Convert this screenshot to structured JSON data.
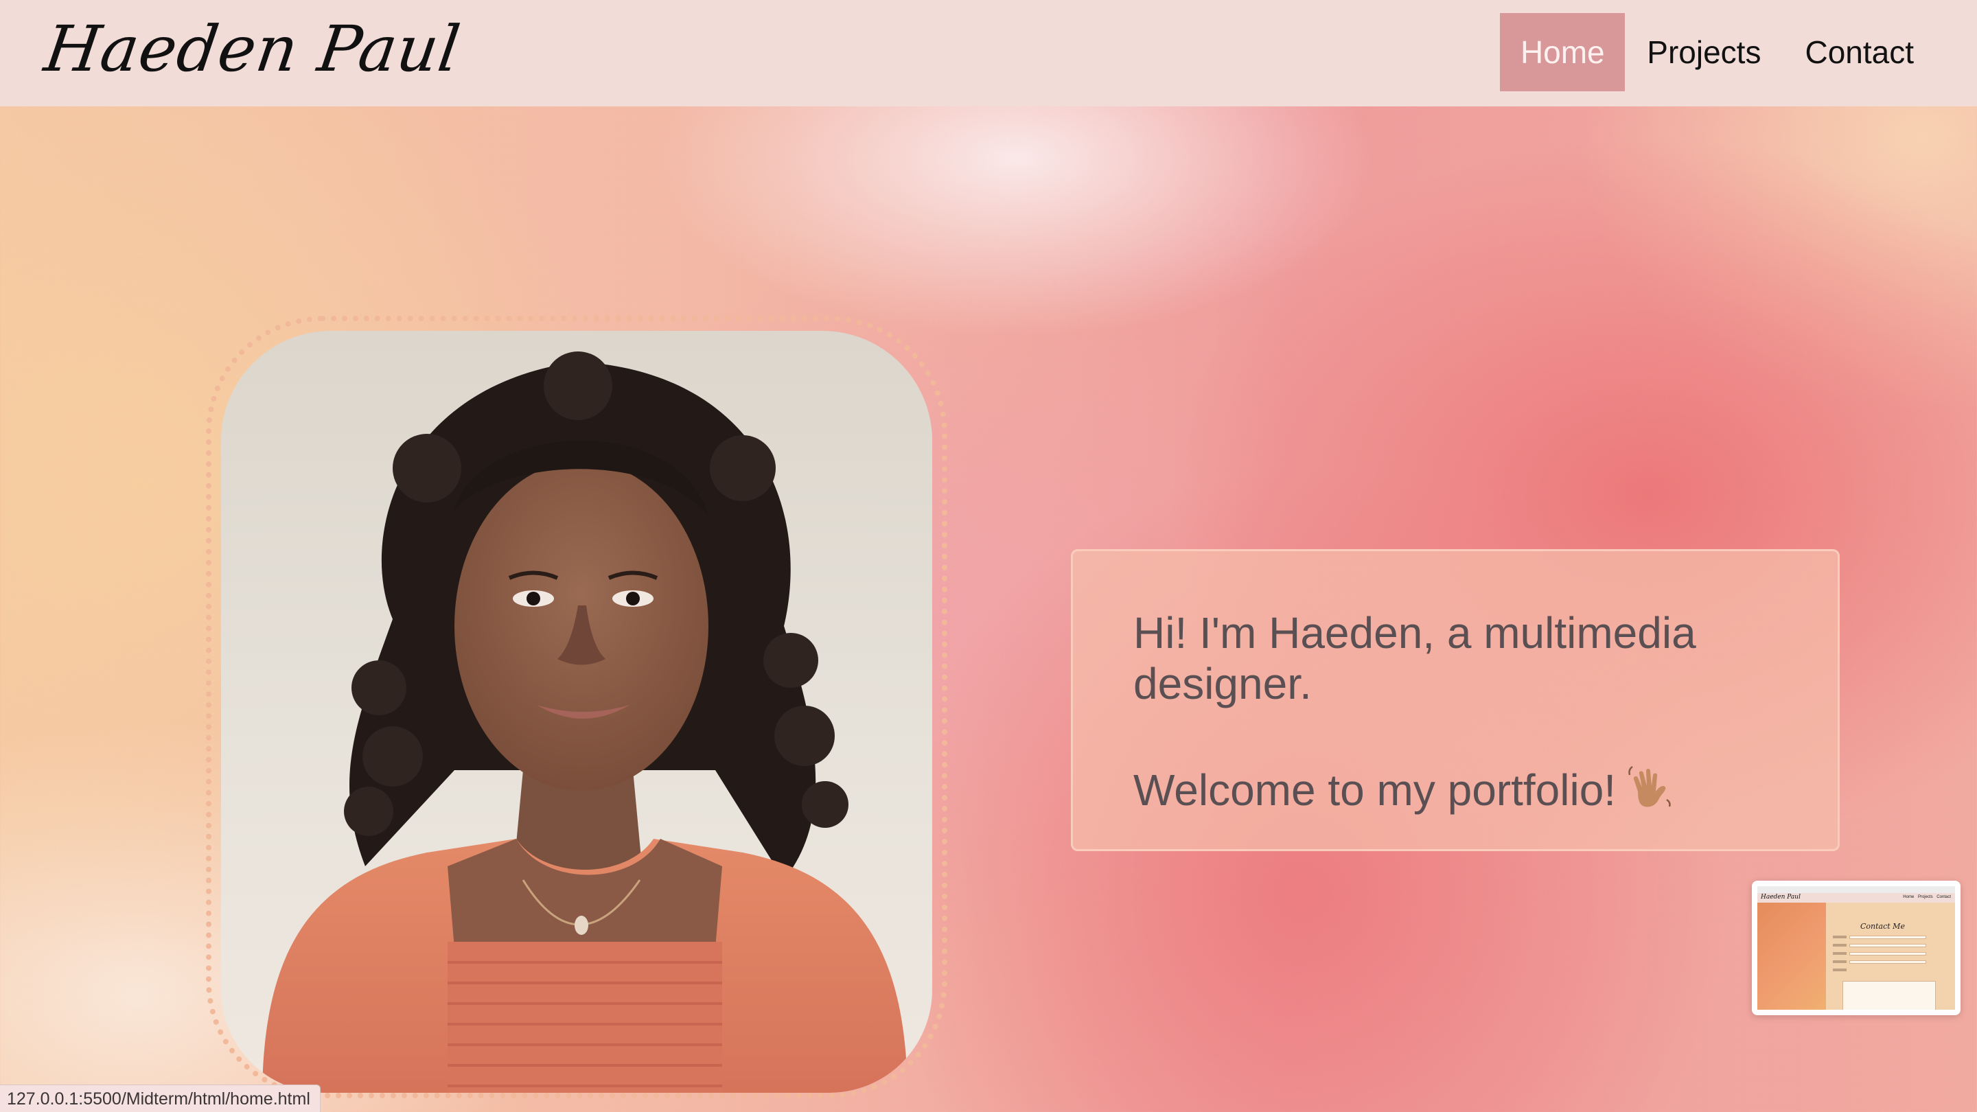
{
  "header": {
    "logo": "Haeden Paul",
    "nav": {
      "home_label": "Home",
      "projects_label": "Projects",
      "contact_label": "Contact"
    },
    "active_nav": "Home"
  },
  "hero": {
    "portrait_icon": "portrait-photo",
    "intro_line1": "Hi! I'm Haeden, a multimedia designer.",
    "intro_line2": "Welcome to my portfolio!",
    "intro_emoji_icon": "waving-hand-icon"
  },
  "tab_preview": {
    "logo": "Haeden Paul",
    "links": "Home Projects Contact",
    "title": "Contact Me"
  },
  "status_bar": {
    "url": "127.0.0.1:5500/Midterm/html/home.html"
  },
  "colors": {
    "header_bg": "#f1dcd7",
    "active_nav_bg": "#d8989a",
    "intro_text": "#5a4f52",
    "portrait_border": "#f2b89a"
  }
}
